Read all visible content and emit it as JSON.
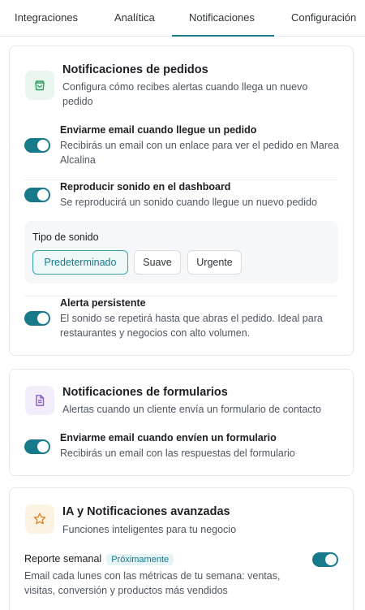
{
  "tabs": {
    "integraciones": "Integraciones",
    "analitica": "Analítica",
    "notificaciones": "Notificaciones",
    "configuracion": "Configuración"
  },
  "orders": {
    "title": "Notificaciones de pedidos",
    "description": "Configura cómo recibes alertas cuando llega un nuevo pedido",
    "email": {
      "title": "Enviarme email cuando llegue un pedido",
      "description": "Recibirás un email con un enlace para ver el pedido en Marea Alcalina",
      "enabled": true
    },
    "sound": {
      "title": "Reproducir sonido en el dashboard",
      "description": "Se reproducirá un sonido cuando llegue un nuevo pedido",
      "enabled": true
    },
    "sound_type": {
      "label": "Tipo de sonido",
      "options": [
        "Predeterminado",
        "Suave",
        "Urgente"
      ],
      "selected": "Predeterminado"
    },
    "persistent": {
      "title": "Alerta persistente",
      "description": "El sonido se repetirá hasta que abras el pedido. Ideal para restaurantes y negocios con alto volumen.",
      "enabled": true
    }
  },
  "forms": {
    "title": "Notificaciones de formularios",
    "description": "Alertas cuando un cliente envía un formulario de contacto",
    "email": {
      "title": "Enviarme email cuando envíen un formulario",
      "description": "Recibirás un email con las respuestas del formulario",
      "enabled": true
    }
  },
  "ai": {
    "title": "IA y Notificaciones avanzadas",
    "description": "Funciones inteligentes para tu negocio",
    "weekly_report": {
      "title": "Reporte semanal",
      "badge": "Próximamente",
      "description": "Email cada lunes con las métricas de tu semana: ventas, visitas, conversión y productos más vendidos",
      "enabled": true
    }
  },
  "colors": {
    "accent": "#167a8a",
    "orders_icon_bg": "#e8f6ee",
    "orders_icon": "#2e9e62",
    "forms_icon_bg": "#f3ecfa",
    "forms_icon": "#8b5cc6",
    "ai_icon_bg": "#fdf3e3",
    "ai_icon": "#e0862c"
  },
  "icons": {
    "orders": "shopping-bag-icon",
    "forms": "document-icon",
    "ai": "star-icon"
  }
}
